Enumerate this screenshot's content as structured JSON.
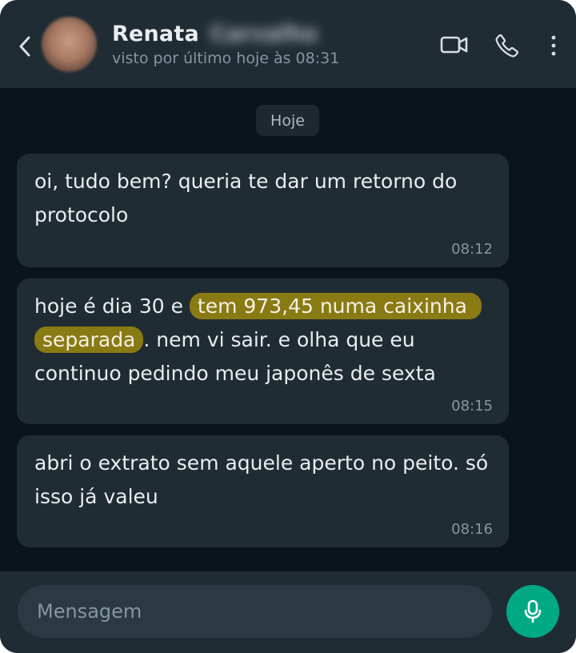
{
  "header": {
    "contact_name": "Renata",
    "contact_surname_blurred": "Carvalho",
    "status": "visto por último hoje às 08:31",
    "icons": {
      "back": "back-chevron-icon",
      "video": "video-camera-icon",
      "call": "phone-icon",
      "more": "more-vertical-icon"
    }
  },
  "chat": {
    "day_label": "Hoje",
    "messages": [
      {
        "text": "oi, tudo bem? queria te dar um retorno do protocolo",
        "time": "08:12"
      },
      {
        "text_before": "hoje é dia 30 e ",
        "text_highlight": "tem 973,45 numa caixinha separada",
        "text_after": ". nem vi sair. e olha que eu continuo pedindo meu japonês de sexta",
        "time": "08:15"
      },
      {
        "text": "abri o extrato sem aquele aperto no peito. só isso já valeu",
        "time": "08:16"
      }
    ]
  },
  "composer": {
    "placeholder": "Mensagem",
    "value": "",
    "mic_icon": "microphone-icon"
  },
  "colors": {
    "background": "#0b141a",
    "header": "#1f2c34",
    "bubble": "#202c33",
    "highlight": "#8a7a14",
    "accent": "#00a884",
    "text_primary": "#e9edef",
    "text_secondary": "#8696a0"
  }
}
